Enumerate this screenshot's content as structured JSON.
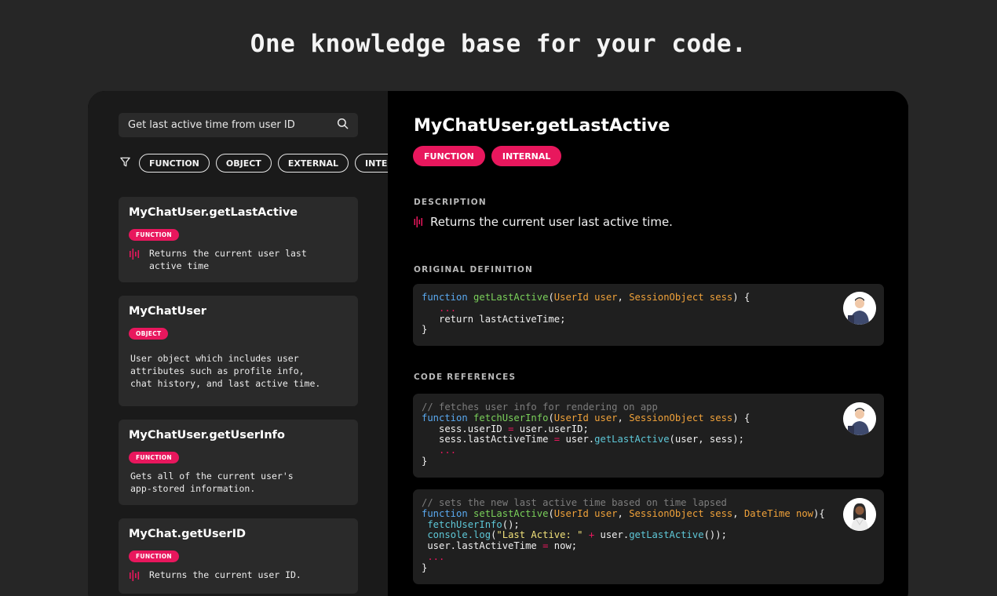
{
  "headline": "One knowledge base for your code.",
  "search": {
    "query": "Get last active time from user ID"
  },
  "filters": {
    "chips": [
      "FUNCTION",
      "OBJECT",
      "EXTERNAL",
      "INTERNAL"
    ]
  },
  "results": [
    {
      "title": "MyChatUser.getLastActive",
      "tag": "FUNCTION",
      "description": "Returns the current user last\nactive time"
    },
    {
      "title": "MyChatUser",
      "tag": "OBJECT",
      "description": "User object which includes user\nattributes such as profile info,\nchat history, and last active time."
    },
    {
      "title": "MyChatUser.getUserInfo",
      "tag": "FUNCTION",
      "description": "Gets all of the current user's\napp-stored information."
    },
    {
      "title": "MyChat.getUserID",
      "tag": "FUNCTION",
      "description": "Returns the current user ID."
    }
  ],
  "detail": {
    "title": "MyChatUser.getLastActive",
    "tags": [
      "FUNCTION",
      "INTERNAL"
    ],
    "description_label": "DESCRIPTION",
    "description": "Returns the current user last active time.",
    "original_definition_label": "ORIGINAL DEFINITION",
    "code_references_label": "CODE REFERENCES"
  },
  "colors": {
    "accent": "#e8175d",
    "background": "#262626",
    "panel_left": "#1a1a1a",
    "panel_right": "#000000",
    "card": "#2a2a2a",
    "code_keyword": "#5aa9f0",
    "code_function": "#7ad05a",
    "code_type": "#f0a23a",
    "code_comment": "#7d7d7d"
  },
  "icons": {
    "search": "search-icon",
    "filter": "filter-icon",
    "summary": "waveform-icon",
    "author": "avatar"
  }
}
